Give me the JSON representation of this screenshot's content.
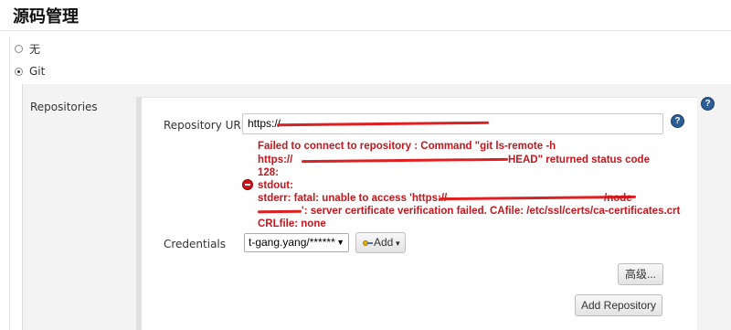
{
  "section": {
    "title": "源码管理"
  },
  "scm_options": [
    {
      "label": "无",
      "checked": false
    },
    {
      "label": "Git",
      "checked": true
    }
  ],
  "repositories": {
    "label": "Repositories",
    "repository_url": {
      "label": "Repository URL",
      "value": "https://"
    },
    "error": {
      "lines": [
        "Failed to connect to repository : Command \"git ls-remote -h",
        "https://",
        "HEAD\" returned status code",
        "128:",
        "stdout:",
        "stderr: fatal: unable to access 'https://",
        "/node",
        "': server certificate verification failed. CAfile: /etc/ssl/certs/ca-certificates.crt",
        "CRLfile: none"
      ]
    },
    "credentials": {
      "label": "Credentials",
      "selected": "t-gang.yang/******",
      "add_label": "Add"
    },
    "advanced_label": "高级...",
    "add_repository_label": "Add Repository"
  },
  "colors": {
    "error": "#c4161c",
    "help": "#2b5d96",
    "redaction": "#e02020"
  },
  "icons": {
    "help": "help-icon",
    "error": "error-icon",
    "key": "key-icon",
    "caret": "caret-down-icon"
  }
}
